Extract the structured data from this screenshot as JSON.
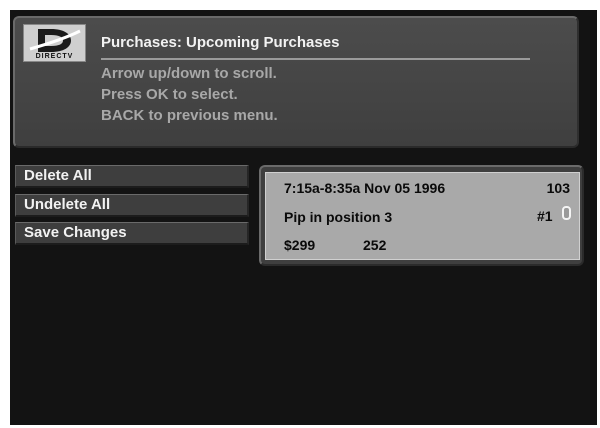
{
  "header": {
    "logo_text": "DIRECTV",
    "title": "Purchases: Upcoming Purchases",
    "instructions": [
      "Arrow up/down to scroll.",
      "Press OK to select.",
      "BACK to previous menu."
    ]
  },
  "menu": {
    "items": [
      {
        "label": "Delete All"
      },
      {
        "label": "Undelete All"
      },
      {
        "label": "Save Changes"
      }
    ]
  },
  "purchase": {
    "time_range": "7:15a-8:35a Nov 05 1996",
    "channel": "103",
    "title": "Pip in position 3",
    "number": "#1",
    "price": "$299",
    "code": "252",
    "checked": false
  }
}
